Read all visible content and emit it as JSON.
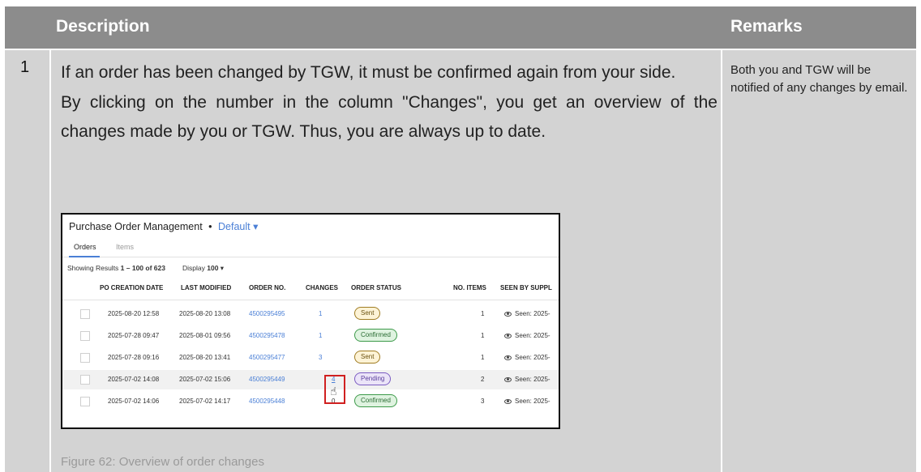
{
  "header": {
    "description": "Description",
    "remarks": "Remarks"
  },
  "row": {
    "number": "1",
    "paragraphs": [
      "If an order has been changed by TGW, it must be confirmed again from your side.",
      "By clicking on the number in the column \"Changes\", you get an overview of the changes made by you or TGW. Thus, you are always up to date."
    ],
    "remarks": "Both you and TGW will be notified of any changes by email.",
    "caption": "Figure 62: Overview of order changes"
  },
  "screenshot": {
    "title": "Purchase Order Management",
    "separator": "•",
    "view_label": "Default",
    "view_chevron": "▾",
    "tabs": [
      "Orders",
      "Items"
    ],
    "results_prefix": "Showing Results ",
    "results_range": "1 – 100 of 623",
    "display_prefix": "Display ",
    "display_value": "100",
    "display_chevron": "▾",
    "columns": [
      "PO CREATION DATE",
      "LAST MODIFIED",
      "ORDER NO.",
      "CHANGES",
      "ORDER STATUS",
      "NO. ITEMS",
      "SEEN BY SUPPL"
    ],
    "rows": [
      {
        "created": "2025-08-20 12:58",
        "modified": "2025-08-20 13:08",
        "order_no": "4500295495",
        "changes": "1",
        "status": "Sent",
        "items": "1",
        "seen": "Seen: 2025-"
      },
      {
        "created": "2025-07-28 09:47",
        "modified": "2025-08-01 09:56",
        "order_no": "4500295478",
        "changes": "1",
        "status": "Confirmed",
        "items": "1",
        "seen": "Seen: 2025-"
      },
      {
        "created": "2025-07-28 09:16",
        "modified": "2025-08-20 13:41",
        "order_no": "4500295477",
        "changes": "3",
        "status": "Sent",
        "items": "1",
        "seen": "Seen: 2025-"
      },
      {
        "created": "2025-07-02 14:08",
        "modified": "2025-07-02 15:06",
        "order_no": "4500295449",
        "changes": "4",
        "status": "Pending",
        "items": "2",
        "seen": "Seen: 2025-"
      },
      {
        "created": "2025-07-02 14:06",
        "modified": "2025-07-02 14:17",
        "order_no": "4500295448",
        "changes": "0",
        "status": "Confirmed",
        "items": "3",
        "seen": "Seen: 2025-"
      }
    ],
    "cursor_icon": "☝",
    "colors": {
      "link": "#4a7fd6",
      "highlight": "#d02020",
      "header_bg": "#8c8c8c",
      "cell_bg": "#d3d3d3"
    }
  }
}
